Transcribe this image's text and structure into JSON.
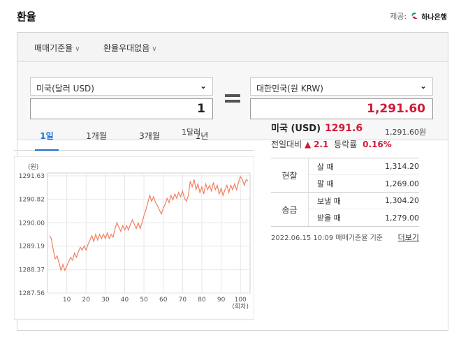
{
  "header": {
    "title": "환율",
    "provider_label": "제공:",
    "bank_name": "하나은행"
  },
  "filters": [
    {
      "label": "매매기준율"
    },
    {
      "label": "환율우대없음"
    }
  ],
  "converter": {
    "from_currency": "미국(달러 USD)",
    "to_currency": "대한민국(원 KRW)",
    "from_amount": "1",
    "to_amount": "1,291.60",
    "from_unit": "1달러",
    "to_unit": "1,291.60원"
  },
  "tabs": [
    {
      "label": "1일",
      "active": true
    },
    {
      "label": "1개월",
      "active": false
    },
    {
      "label": "3개월",
      "active": false
    },
    {
      "label": "1년",
      "active": false
    }
  ],
  "summary": {
    "currency": "미국 (USD)",
    "rate": "1291.6",
    "change_label": "전일대비",
    "change_arrow": "▲",
    "change_value": "2.1",
    "ratio_label": "등락률",
    "ratio_value": "0.16%"
  },
  "rates_table": [
    {
      "group": "현찰",
      "rows": [
        {
          "label": "살 때",
          "value": "1,314.20"
        },
        {
          "label": "팔 때",
          "value": "1,269.00"
        }
      ]
    },
    {
      "group": "송금",
      "rows": [
        {
          "label": "보낼 때",
          "value": "1,304.20"
        },
        {
          "label": "받을 때",
          "value": "1,279.00"
        }
      ]
    }
  ],
  "footer": {
    "timestamp": "2022.06.15 10:09 매매기준율 기준",
    "more": "더보기"
  },
  "colors": {
    "accent": "#1c6fd4",
    "up": "#d01a38",
    "line": "#f08060"
  },
  "chart_data": {
    "type": "line",
    "ylabel": "(원)",
    "xlabel": "(회차)",
    "yticks": [
      "1291.63",
      "1290.82",
      "1290.00",
      "1289.19",
      "1288.37",
      "1287.56"
    ],
    "ylim": [
      1287.56,
      1291.63
    ],
    "xticks": [
      10,
      20,
      30,
      40,
      50,
      60,
      70,
      80,
      90,
      100
    ],
    "xlim": [
      0,
      105
    ],
    "x": [
      1,
      2,
      3,
      4,
      5,
      6,
      7,
      8,
      9,
      10,
      11,
      12,
      13,
      14,
      15,
      16,
      17,
      18,
      19,
      20,
      21,
      22,
      23,
      24,
      25,
      26,
      27,
      28,
      29,
      30,
      31,
      32,
      33,
      34,
      35,
      36,
      37,
      38,
      39,
      40,
      41,
      42,
      43,
      44,
      45,
      46,
      47,
      48,
      49,
      50,
      51,
      52,
      53,
      54,
      55,
      56,
      57,
      58,
      59,
      60,
      61,
      62,
      63,
      64,
      65,
      66,
      67,
      68,
      69,
      70,
      71,
      72,
      73,
      74,
      75,
      76,
      77,
      78,
      79,
      80,
      81,
      82,
      83,
      84,
      85,
      86,
      87,
      88,
      89,
      90,
      91,
      92,
      93,
      94,
      95,
      96,
      97,
      98,
      99,
      100,
      101,
      102,
      103,
      104
    ],
    "values": [
      1289.55,
      1289.45,
      1289.05,
      1288.75,
      1288.85,
      1288.6,
      1288.35,
      1288.55,
      1288.35,
      1288.5,
      1288.65,
      1288.8,
      1288.7,
      1288.95,
      1288.8,
      1289.0,
      1289.15,
      1289.05,
      1289.2,
      1289.05,
      1289.25,
      1289.4,
      1289.55,
      1289.35,
      1289.6,
      1289.4,
      1289.6,
      1289.45,
      1289.6,
      1289.45,
      1289.65,
      1289.45,
      1289.6,
      1289.5,
      1289.8,
      1290.0,
      1289.85,
      1289.7,
      1289.9,
      1289.75,
      1289.9,
      1289.75,
      1289.95,
      1290.1,
      1289.95,
      1289.8,
      1290.0,
      1289.8,
      1290.0,
      1290.25,
      1290.45,
      1290.7,
      1290.95,
      1290.75,
      1290.9,
      1290.7,
      1290.6,
      1290.45,
      1290.3,
      1290.5,
      1290.65,
      1290.85,
      1290.7,
      1290.95,
      1290.8,
      1291.0,
      1290.85,
      1291.05,
      1290.9,
      1291.1,
      1290.85,
      1290.75,
      1290.95,
      1291.45,
      1291.25,
      1291.5,
      1291.15,
      1291.35,
      1291.05,
      1291.25,
      1291.0,
      1291.35,
      1291.15,
      1291.3,
      1291.1,
      1291.4,
      1291.15,
      1291.3,
      1291.0,
      1291.2,
      1290.95,
      1291.15,
      1291.3,
      1291.05,
      1291.3,
      1291.15,
      1291.35,
      1291.15,
      1291.4,
      1291.6,
      1291.5,
      1291.3,
      1291.5,
      1291.45
    ]
  }
}
